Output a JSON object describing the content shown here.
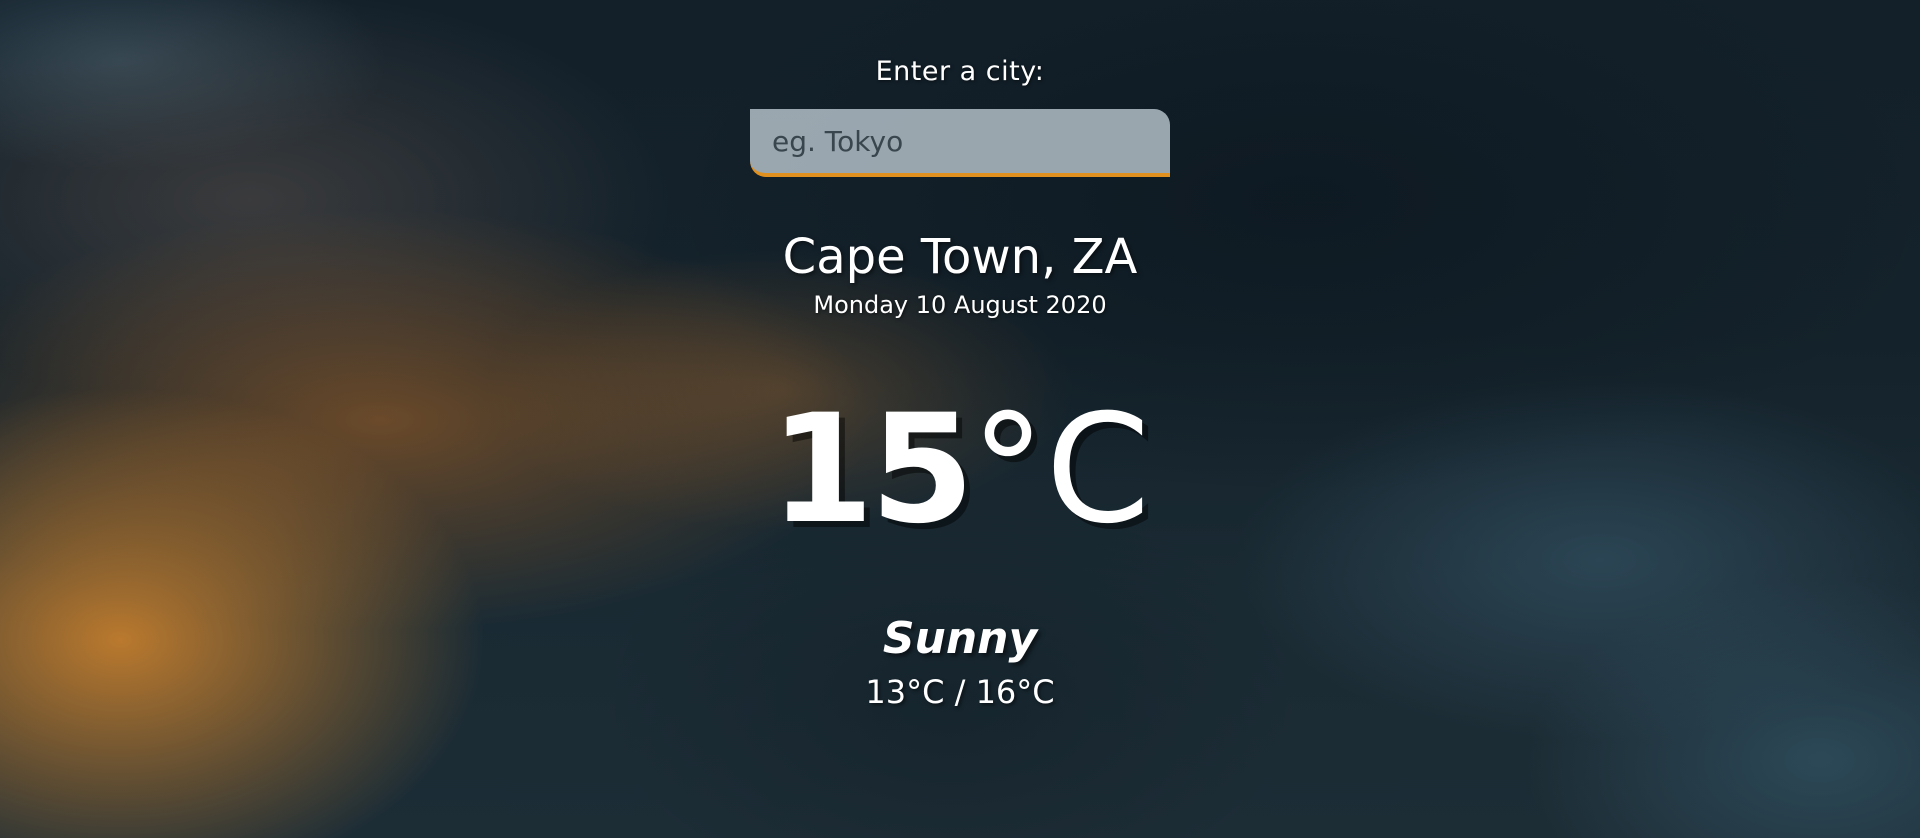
{
  "search": {
    "label": "Enter a city:",
    "placeholder": "eg. Tokyo",
    "value": ""
  },
  "location": {
    "city": "Cape Town, ZA",
    "date": "Monday 10 August 2020"
  },
  "weather": {
    "temperature_value": "15",
    "temperature_unit": "°C",
    "condition": "Sunny",
    "min_max": "13°C / 16°C"
  },
  "colors": {
    "accent": "#e0901f",
    "text": "#ffffff"
  }
}
